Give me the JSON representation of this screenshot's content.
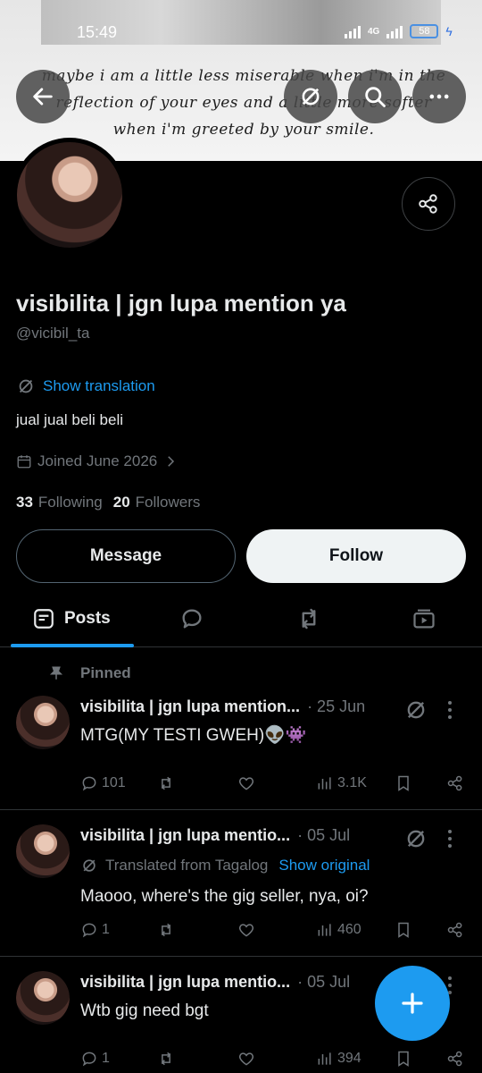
{
  "status_bar": {
    "time": "15:49",
    "network": "4G",
    "battery": "58"
  },
  "banner": {
    "quote": "maybe i am a little less miserable when i'm in the reflection of your eyes and a little more softer when i'm greeted by your smile."
  },
  "profile": {
    "name": "visibilita | jgn lupa mention ya",
    "handle": "@vicibil_ta",
    "show_translation": "Show translation",
    "bio": "jual jual beli beli",
    "joined": "Joined June 2026",
    "following_count": "33",
    "following_label": "Following",
    "followers_count": "20",
    "followers_label": "Followers"
  },
  "buttons": {
    "message": "Message",
    "follow": "Follow"
  },
  "tabs": {
    "posts": "Posts"
  },
  "pinned_label": "Pinned",
  "posts": [
    {
      "name": "visibilita | jgn lupa mention...",
      "date": "· 25 Jun",
      "text": "MTG(MY TESTI GWEH)👽👾",
      "replies": "101",
      "views": "3.1K"
    },
    {
      "name": "visibilita | jgn lupa mentio...",
      "date": "· 05 Jul",
      "translated_from": "Translated from Tagalog",
      "show_original": "Show original",
      "text": "Maooo, where's the gig seller, nya, oi?",
      "replies": "1",
      "views": "460"
    },
    {
      "name": "visibilita | jgn lupa mentio...",
      "date": "· 05 Jul",
      "text": "Wtb gig need bgt",
      "replies": "1",
      "views": "394"
    }
  ],
  "colors": {
    "accent": "#1d9bf0",
    "muted": "#71767b",
    "background": "#000000"
  }
}
